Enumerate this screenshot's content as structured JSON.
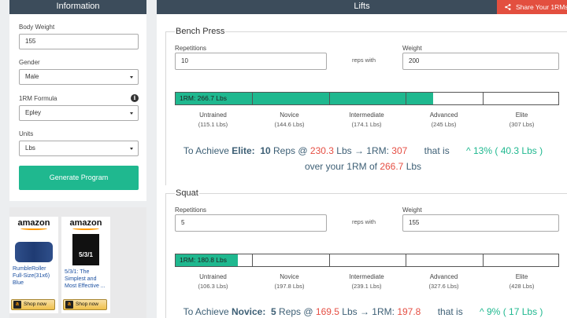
{
  "info": {
    "title": "Information",
    "body_weight_label": "Body Weight",
    "body_weight_value": "155",
    "gender_label": "Gender",
    "gender_value": "Male",
    "formula_label": "1RM Formula",
    "formula_value": "Epley",
    "units_label": "Units",
    "units_value": "Lbs",
    "generate_label": "Generate Program"
  },
  "ads": [
    {
      "logo": "amazon",
      "text": "RumbleRoller Full-Size(31x6) Blue",
      "button": "Shop now"
    },
    {
      "logo": "amazon",
      "text": "5/3/1: The Simplest and Most Effective ...",
      "image_text": "5/3/1",
      "button": "Shop now"
    }
  ],
  "lifts_header": {
    "title": "Lifts",
    "share_label": "Share Your 1RMs"
  },
  "lifts": [
    {
      "name": "Bench Press",
      "reps_label": "Repetitions",
      "reps_value": "10",
      "connector": "reps with",
      "weight_label": "Weight",
      "weight_value": "200",
      "bar_label": "1RM: 266.7 Lbs",
      "bar_fill_fraction": 0.672,
      "levels": [
        {
          "name": "Untrained",
          "value": "(115.1 Lbs)"
        },
        {
          "name": "Novice",
          "value": "(144.6 Lbs)"
        },
        {
          "name": "Intermediate",
          "value": "(174.1 Lbs)"
        },
        {
          "name": "Advanced",
          "value": "(245 Lbs)"
        },
        {
          "name": "Elite",
          "value": "(307 Lbs)"
        }
      ],
      "achieve": {
        "prefix": "To Achieve",
        "level": "Elite:",
        "reps": "10",
        "reps_word": "Reps @",
        "weight": "230.3",
        "unit_arrow": "Lbs → 1RM:",
        "target": "307",
        "that_is": "that is",
        "pct": "^ 13%",
        "gain_open": "(",
        "gain": "40.3 Lbs",
        "gain_close": ")",
        "over_text": "over your 1RM of",
        "current": "266.7",
        "unit": "Lbs"
      }
    },
    {
      "name": "Squat",
      "reps_label": "Repetitions",
      "reps_value": "5",
      "connector": "reps with",
      "weight_label": "Weight",
      "weight_value": "155",
      "bar_label": "1RM: 180.8 Lbs",
      "bar_fill_fraction": 0.162,
      "levels": [
        {
          "name": "Untrained",
          "value": "(106.3 Lbs)"
        },
        {
          "name": "Novice",
          "value": "(197.8 Lbs)"
        },
        {
          "name": "Intermediate",
          "value": "(239.1 Lbs)"
        },
        {
          "name": "Advanced",
          "value": "(327.6 Lbs)"
        },
        {
          "name": "Elite",
          "value": "(428 Lbs)"
        }
      ],
      "achieve": {
        "prefix": "To Achieve",
        "level": "Novice:",
        "reps": "5",
        "reps_word": "Reps @",
        "weight": "169.5",
        "unit_arrow": "Lbs → 1RM:",
        "target": "197.8",
        "that_is": "that is",
        "pct": "^ 9%",
        "gain_open": "(",
        "gain": "17 Lbs",
        "gain_close": ")"
      }
    }
  ]
}
